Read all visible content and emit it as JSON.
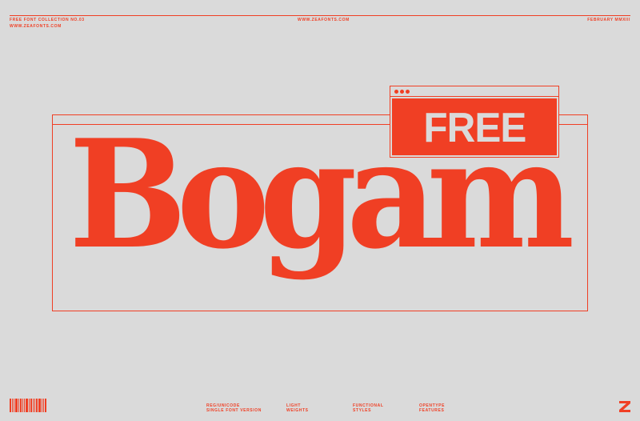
{
  "header": {
    "left_line1": "FREE FONT COLLECTION NO.03",
    "left_line2": "WWW.ZEAFONTS.COM",
    "center": "WWW.ZEAFONTS.COM",
    "right": "FEBRUARY MMXIII"
  },
  "badge": {
    "label": "FREE"
  },
  "title": "Bogam",
  "footer": {
    "col1_line1": "REG/UNICODE",
    "col1_line2": "SINGLE FONT VERSION",
    "col2_line1": "LIGHT",
    "col2_line2": "WEIGHTS",
    "col3_line1": "FUNCTIONAL",
    "col3_line2": "STYLES",
    "col4_line1": "OPENTYPE",
    "col4_line2": "FEATURES"
  },
  "colors": {
    "accent": "#f03f24",
    "background": "#dadada"
  },
  "icons": {
    "barcode": "barcode-icon",
    "logo": "zea-logo-icon"
  }
}
